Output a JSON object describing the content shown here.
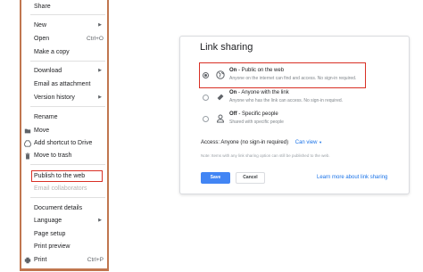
{
  "file_menu": {
    "items": [
      {
        "label": "Share",
        "shortcut": "",
        "submenu": false,
        "icon": "",
        "disabled": false
      },
      {
        "label": "New",
        "shortcut": "",
        "submenu": true,
        "icon": "",
        "disabled": false
      },
      {
        "label": "Open",
        "shortcut": "Ctrl+O",
        "submenu": false,
        "icon": "",
        "disabled": false
      },
      {
        "label": "Make a copy",
        "shortcut": "",
        "submenu": false,
        "icon": "",
        "disabled": false
      },
      {
        "label": "Download",
        "shortcut": "",
        "submenu": true,
        "icon": "",
        "disabled": false
      },
      {
        "label": "Email as attachment",
        "shortcut": "",
        "submenu": false,
        "icon": "",
        "disabled": false
      },
      {
        "label": "Version history",
        "shortcut": "",
        "submenu": true,
        "icon": "",
        "disabled": false
      },
      {
        "label": "Rename",
        "shortcut": "",
        "submenu": false,
        "icon": "",
        "disabled": false
      },
      {
        "label": "Move",
        "shortcut": "",
        "submenu": false,
        "icon": "folder-icon",
        "disabled": false
      },
      {
        "label": "Add shortcut to Drive",
        "shortcut": "",
        "submenu": false,
        "icon": "drive-shortcut-icon",
        "disabled": false
      },
      {
        "label": "Move to trash",
        "shortcut": "",
        "submenu": false,
        "icon": "trash-icon",
        "disabled": false
      },
      {
        "label": "Publish to the web",
        "shortcut": "",
        "submenu": false,
        "icon": "",
        "disabled": false
      },
      {
        "label": "Email collaborators",
        "shortcut": "",
        "submenu": false,
        "icon": "",
        "disabled": true
      },
      {
        "label": "Document details",
        "shortcut": "",
        "submenu": false,
        "icon": "",
        "disabled": false
      },
      {
        "label": "Language",
        "shortcut": "",
        "submenu": true,
        "icon": "",
        "disabled": false
      },
      {
        "label": "Page setup",
        "shortcut": "",
        "submenu": false,
        "icon": "",
        "disabled": false
      },
      {
        "label": "Print preview",
        "shortcut": "",
        "submenu": false,
        "icon": "",
        "disabled": false
      },
      {
        "label": "Print",
        "shortcut": "Ctrl+P",
        "submenu": false,
        "icon": "print-icon",
        "disabled": false
      }
    ]
  },
  "dialog": {
    "title": "Link sharing",
    "options": [
      {
        "title_bold": "On",
        "title_rest": " - Public on the web",
        "desc": "Anyone on the internet can find and access. No sign-in required.",
        "selected": true,
        "icon": "globe-icon"
      },
      {
        "title_bold": "On",
        "title_rest": " - Anyone with the link",
        "desc": "Anyone who has the link can access. No sign-in required.",
        "selected": false,
        "icon": "link-icon"
      },
      {
        "title_bold": "Off",
        "title_rest": " - Specific people",
        "desc": "Shared with specific people",
        "selected": false,
        "icon": "person-icon"
      }
    ],
    "access_label": "Access:",
    "access_value": "Anyone (no sign-in required)",
    "access_link": "Can view",
    "note": "Note: Items with any link sharing option can still be published to the web.",
    "save_label": "Save",
    "cancel_label": "Cancel",
    "learn_more": "Learn more about link sharing"
  },
  "colors": {
    "accent": "#1a73e8",
    "highlight_border": "#d93025",
    "frame_border": "#c0764f",
    "save_button": "#4285f4"
  }
}
